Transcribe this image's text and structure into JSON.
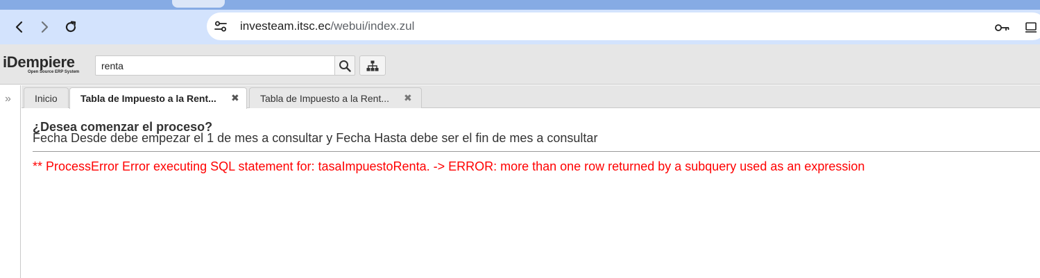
{
  "browser": {
    "url_host": "investeam.itsc.ec",
    "url_path": "/webui/index.zul",
    "icons": [
      "back-icon",
      "forward-icon",
      "reload-icon",
      "site-info-icon",
      "password-key-icon",
      "install-app-icon"
    ]
  },
  "app": {
    "logo_text": "iDempiere",
    "logo_subtext": "Open Source ERP System",
    "search_value": "renta"
  },
  "tabs": [
    {
      "label": "Inicio"
    },
    {
      "label": "Tabla de Impuesto a la Rent..."
    },
    {
      "label": "Tabla de Impuesto a la Rent..."
    }
  ],
  "process": {
    "question": "¿Desea comenzar el proceso?",
    "description": "Fecha Desde debe empezar el 1 de mes a consultar y Fecha Hasta debe ser el fin de mes a consultar",
    "error": "** ProcessError Error executing SQL statement for: tasaImpuestoRenta. -> ERROR: more than one row returned by a subquery used as an expression"
  },
  "colors": {
    "error": "#ff0000",
    "browser_toolbar": "#d3e3fd",
    "tab_strip": "#86abe4"
  }
}
